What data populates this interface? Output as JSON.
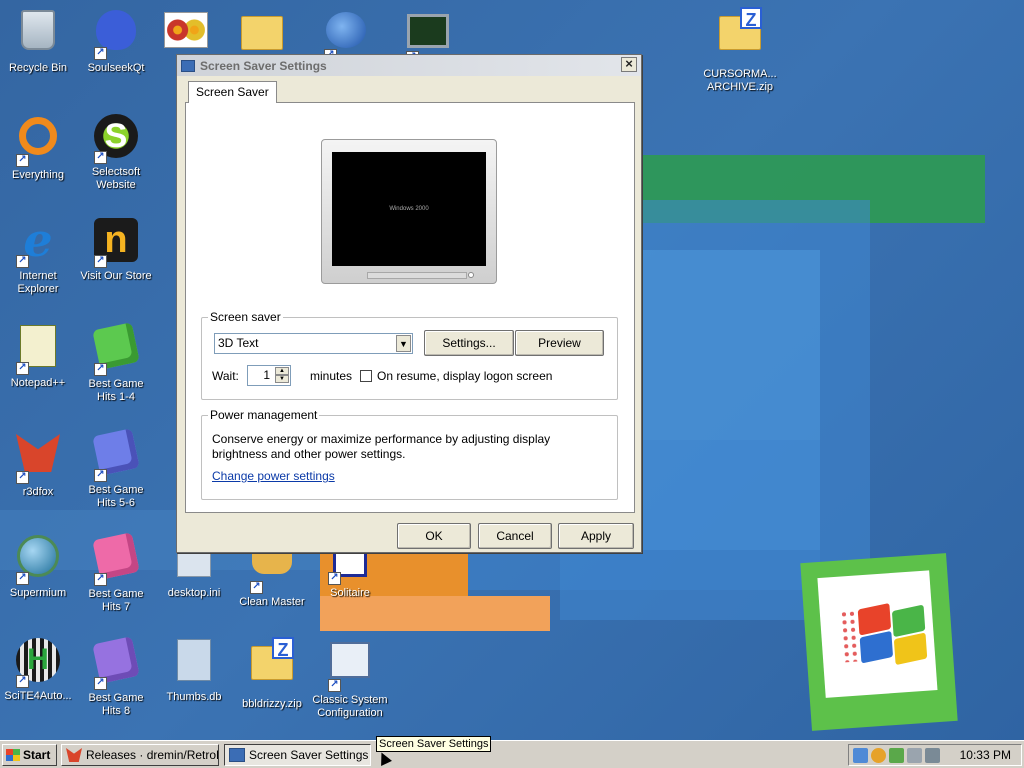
{
  "desktop": {
    "icons": [
      {
        "label": "Recycle Bin",
        "icon": "recycle-bin-icon"
      },
      {
        "label": "SoulseekQt",
        "icon": "soulseek-bird-icon"
      },
      {
        "label": "Everything",
        "icon": "everything-search-icon"
      },
      {
        "label": "Selectsoft Website",
        "icon": "selectsoft-icon"
      },
      {
        "label": "Internet Explorer",
        "icon": "internet-explorer-icon"
      },
      {
        "label": "Visit Our Store",
        "icon": "store-icon"
      },
      {
        "label": "Notepad++",
        "icon": "notepad-plus-plus-icon"
      },
      {
        "label": "Best Game Hits 1-4",
        "icon": "dice-icon"
      },
      {
        "label": "r3dfox",
        "icon": "r3dfox-icon"
      },
      {
        "label": "Best Game Hits 5-6",
        "icon": "dice-icon"
      },
      {
        "label": "Supermium",
        "icon": "supermium-icon"
      },
      {
        "label": "Best Game Hits 7",
        "icon": "dice-icon"
      },
      {
        "label": "desktop.ini",
        "icon": "settings-file-icon"
      },
      {
        "label": "Clean Master",
        "icon": "broom-icon"
      },
      {
        "label": "Solitaire",
        "icon": "cards-icon"
      },
      {
        "label": "SciTE4Auto...",
        "icon": "scite-icon"
      },
      {
        "label": "Best Game Hits 8",
        "icon": "dice-icon"
      },
      {
        "label": "Thumbs.db",
        "icon": "database-file-icon"
      },
      {
        "label": "bbldrizzy.zip",
        "icon": "zip-folder-icon"
      },
      {
        "label": "Classic System Configuration",
        "icon": "system-config-icon"
      },
      {
        "label": "CURSORMA... ARCHIVE.zip",
        "icon": "zip-folder-icon"
      }
    ]
  },
  "dialog": {
    "title": "Screen Saver Settings",
    "tab": "Screen Saver",
    "preview_text": "Windows 2000",
    "screensaver_group": {
      "legend": "Screen saver",
      "selected": "3D Text",
      "settings_button": "Settings...",
      "preview_button": "Preview",
      "wait_label": "Wait:",
      "wait_value": "1",
      "minutes_label": "minutes",
      "logon_checkbox_label": "On resume, display logon screen",
      "logon_checked": false
    },
    "power_group": {
      "legend": "Power management",
      "description": "Conserve energy or maximize performance by adjusting display brightness and other power settings.",
      "link": "Change power settings"
    },
    "buttons": {
      "ok": "OK",
      "cancel": "Cancel",
      "apply": "Apply"
    }
  },
  "taskbar": {
    "start": "Start",
    "tasks": [
      {
        "label": "Releases · dremin/RetroB...",
        "active": false
      },
      {
        "label": "Screen Saver Settings",
        "active": true
      }
    ],
    "tooltip": "Screen Saver Settings",
    "clock": "10:33 PM"
  }
}
